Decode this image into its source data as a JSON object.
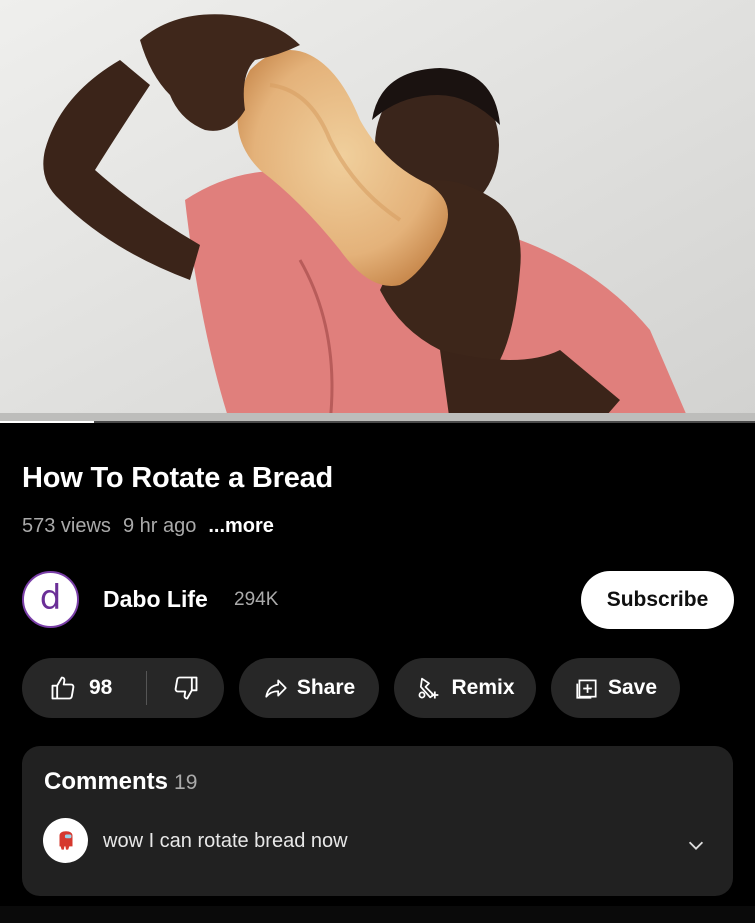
{
  "video": {
    "progress_percent": 12.5,
    "description_icon": "man-holding-bread-image"
  },
  "title": "How To Rotate a Bread",
  "meta": {
    "views": "573 views",
    "age": "9 hr ago",
    "more": "...more"
  },
  "channel": {
    "avatar_letter": "d",
    "name": "Dabo Life",
    "subscribers": "294K",
    "subscribe_label": "Subscribe"
  },
  "actions": {
    "likes": "98",
    "share_label": "Share",
    "remix_label": "Remix",
    "save_label": "Save",
    "icons": [
      "thumbs-up-icon",
      "thumbs-down-icon",
      "share-arrow-icon",
      "remix-icon",
      "save-playlist-icon"
    ]
  },
  "comments": {
    "label": "Comments",
    "count": "19",
    "top_comment": "wow I can rotate bread now",
    "icons": [
      "commenter-avatar-icon",
      "chevron-down-icon"
    ]
  },
  "colors": {
    "background": "#000000",
    "pill": "#272727",
    "comments_card": "#212121",
    "secondary_text": "#aaaaaa",
    "avatar_ring": "#7a3fa8"
  }
}
